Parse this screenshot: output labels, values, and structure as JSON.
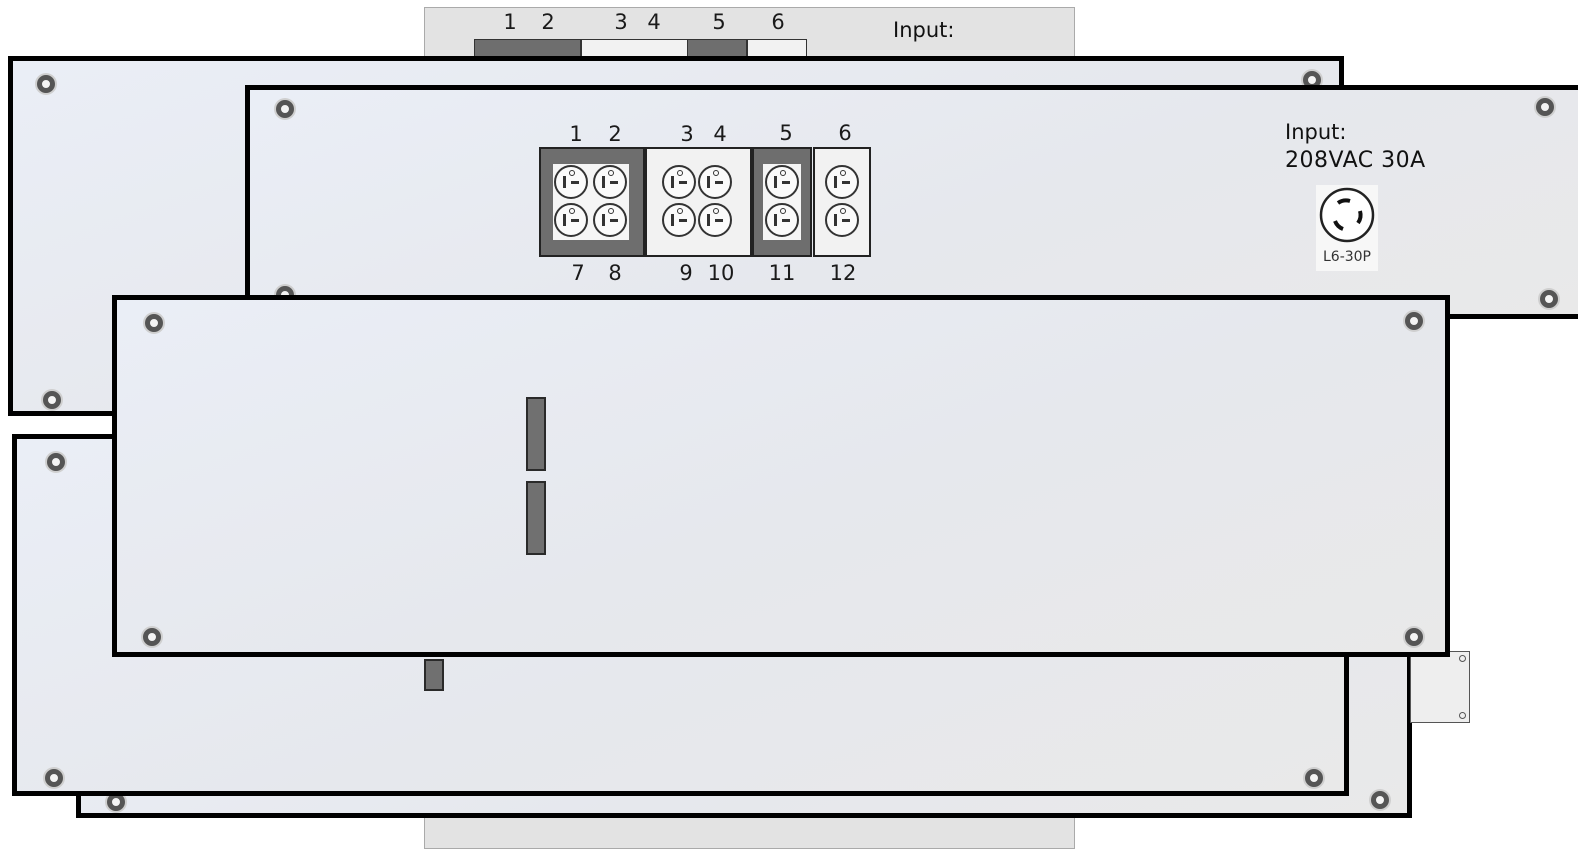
{
  "outlet_labels_top": [
    "1",
    "2",
    "3",
    "4",
    "5",
    "6"
  ],
  "outlet_labels_bottom": [
    "7",
    "8",
    "9",
    "10",
    "11",
    "12"
  ],
  "input_title": "Input:",
  "input_spec": "208VAC 30A",
  "connector_type": "L6-30P",
  "background_panel": {
    "labels_top": [
      "1",
      "2",
      "3",
      "4",
      "5",
      "6"
    ],
    "input_title": "Input:"
  },
  "colors": {
    "panel_border": "#000000",
    "panel_fill": "#e8ebf1",
    "outlet_group_dark": "#6e6e6e",
    "outlet_group_light": "#f2f2f2",
    "slot_fill": "#707070"
  }
}
